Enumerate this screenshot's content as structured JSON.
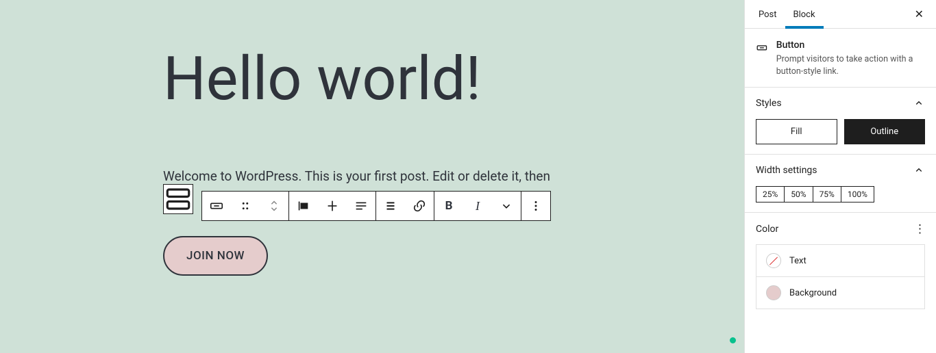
{
  "title": "Hello world!",
  "paragraph": "Welcome to WordPress. This is your first post. Edit or delete it, then",
  "button_label": "JOIN NOW",
  "colors": {
    "canvas_bg": "#cfe1d7",
    "button_bg": "#e5cccc",
    "button_border": "#2f333b",
    "wp_primary": "#007cba"
  },
  "sidebar": {
    "tabs": {
      "post": "Post",
      "block": "Block"
    },
    "active_tab": "block",
    "block": {
      "title": "Button",
      "description": "Prompt visitors to take action with a button-style link."
    },
    "styles": {
      "heading": "Styles",
      "options": [
        "Fill",
        "Outline"
      ],
      "selected": "Outline"
    },
    "width": {
      "heading": "Width settings",
      "options": [
        "25%",
        "50%",
        "75%",
        "100%"
      ]
    },
    "color": {
      "heading": "Color",
      "items": [
        {
          "label": "Text",
          "swatch": "none"
        },
        {
          "label": "Background",
          "swatch": "#e5cccc"
        }
      ]
    }
  }
}
